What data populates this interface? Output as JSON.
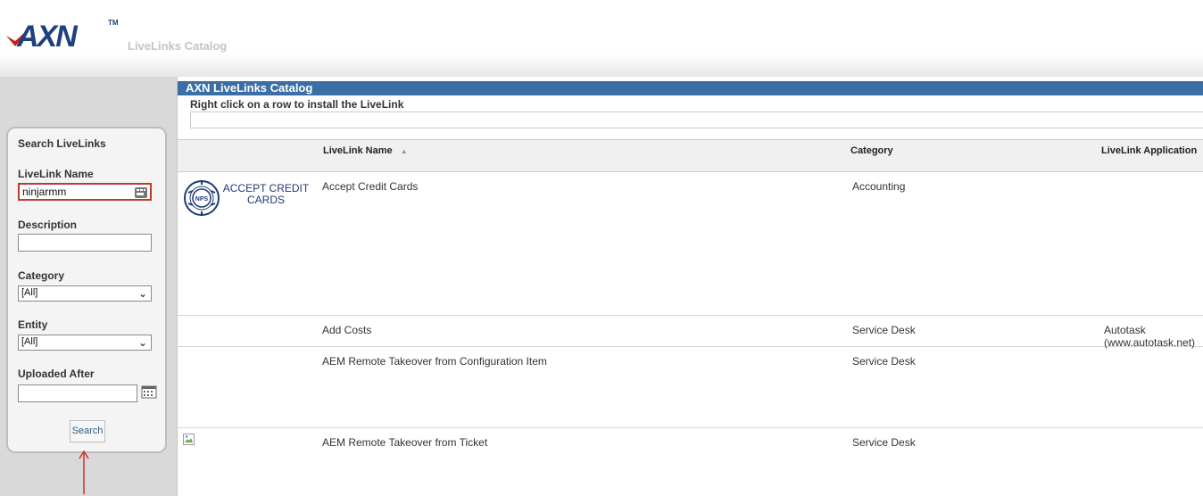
{
  "header": {
    "logo_text": "AXN",
    "logo_tm": "TM",
    "app_title": "LiveLinks Catalog"
  },
  "search_panel": {
    "title": "Search LiveLinks",
    "name_label": "LiveLink Name",
    "name_value": "ninjarmm",
    "description_label": "Description",
    "description_value": "",
    "category_label": "Category",
    "category_value": "[All]",
    "entity_label": "Entity",
    "entity_value": "[All]",
    "uploaded_label": "Uploaded After",
    "uploaded_value": "",
    "search_button": "Search"
  },
  "main": {
    "title": "AXN LiveLinks Catalog",
    "instruction": "Right click on a row to install the LiveLink",
    "columns": {
      "name": "LiveLink Name",
      "category": "Category",
      "application": "LiveLink Application"
    },
    "rows": [
      {
        "name": "Accept Credit Cards",
        "category": "Accounting",
        "application": "",
        "logo_text": "ACCEPT CREDIT CARDS",
        "logo_badge": "NPS"
      },
      {
        "name": "Add Costs",
        "category": "Service Desk",
        "application": "Autotask (www.autotask.net)"
      },
      {
        "name": "AEM Remote Takeover from Configuration Item",
        "category": "Service Desk",
        "application": ""
      },
      {
        "name": "AEM Remote Takeover from Ticket",
        "category": "Service Desk",
        "application": ""
      }
    ]
  },
  "colors": {
    "title_bar": "#3a6ea5",
    "logo_blue": "#1e3f80",
    "logo_red": "#c8201e",
    "highlight": "#c0392b"
  },
  "icons": {
    "logo": "axn-logo-icon",
    "key": "key-icon",
    "calendar": "calendar-icon",
    "sort": "sort-ascending-icon",
    "arrow": "red-arrow-up-icon"
  }
}
